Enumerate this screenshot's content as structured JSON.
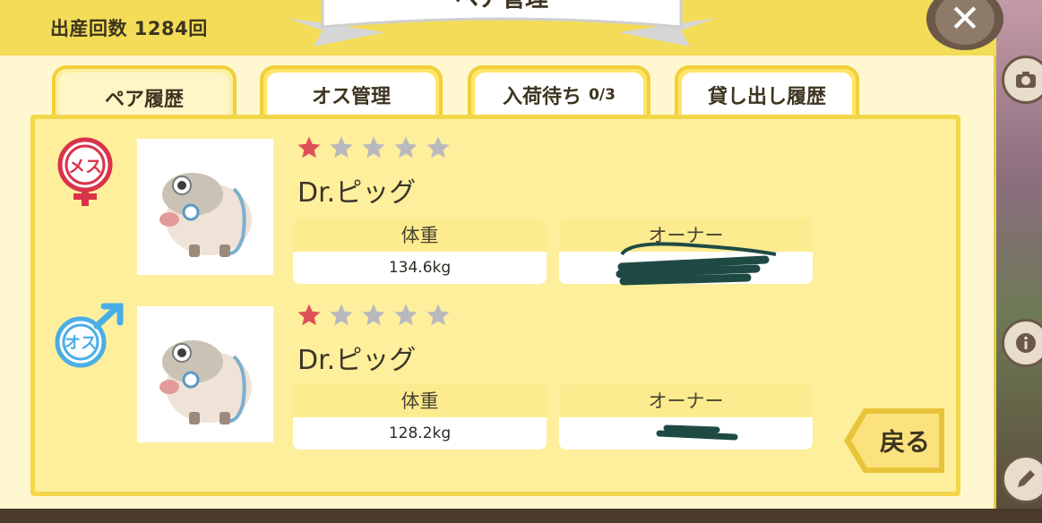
{
  "header": {
    "birth_count_label": "出産回数 1284回",
    "title": "ペア管理"
  },
  "tabs": [
    {
      "label": "ペア履歴",
      "active": true
    },
    {
      "label": "オス管理",
      "active": false
    },
    {
      "label": "入荷待ち",
      "count": "0/3",
      "active": false
    },
    {
      "label": "貸し出し履歴",
      "active": false
    }
  ],
  "pairs": [
    {
      "gender": "メス",
      "gender_icon": "female-icon",
      "rating": 1,
      "max_rating": 5,
      "name": "Dr.ピッグ",
      "weight_label": "体重",
      "weight": "134.6kg",
      "owner_label": "オーナー",
      "owner": ""
    },
    {
      "gender": "オス",
      "gender_icon": "male-icon",
      "rating": 1,
      "max_rating": 5,
      "name": "Dr.ピッグ",
      "weight_label": "体重",
      "weight": "128.2kg",
      "owner_label": "オーナー",
      "owner": ""
    }
  ],
  "buttons": {
    "back_label": "戻る",
    "close_icon": "close-icon"
  },
  "colors": {
    "panel_bg": "#fff7cf",
    "accent_yellow": "#f3dc57",
    "star_filled": "#e0505a",
    "star_empty": "#b9b9bd",
    "female": "#d9334a",
    "male": "#4aaee6",
    "redaction": "#1f4a44"
  }
}
